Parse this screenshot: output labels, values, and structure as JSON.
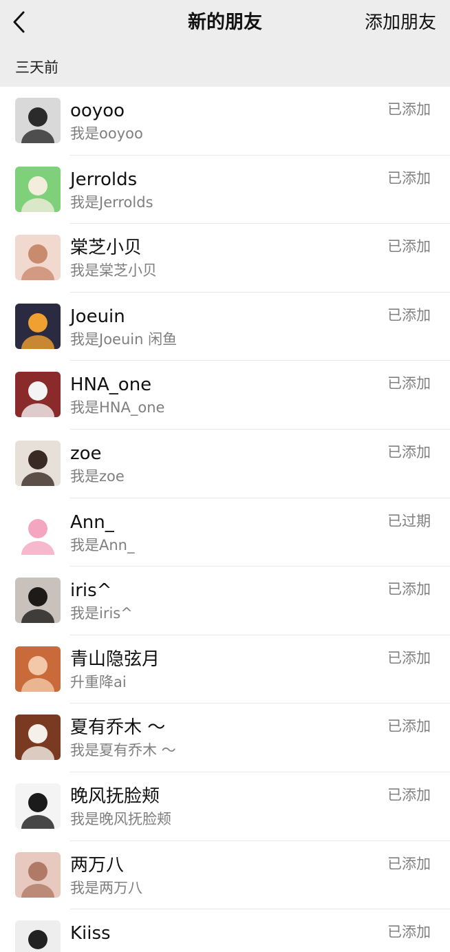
{
  "navbar": {
    "back_icon": "chevron-left-icon",
    "title": "新的朋友",
    "action_label": "添加朋友"
  },
  "section": {
    "label": "三天前"
  },
  "requests": [
    {
      "name": "ooyoo",
      "message": "我是ooyoo",
      "status": "已添加",
      "avatar": "girl-mono-avatar",
      "avatar_bg": "#d9d9d9",
      "avatar_fg": "#2b2b2b"
    },
    {
      "name": "Jerrolds",
      "message": "我是Jerrolds",
      "status": "已添加",
      "avatar": "cartoon-mouse-avatar",
      "avatar_bg": "#7ed07a",
      "avatar_fg": "#f3eedc"
    },
    {
      "name": "棠芝小贝",
      "message": "我是棠芝小贝",
      "status": "已添加",
      "avatar": "selfie-avatar",
      "avatar_bg": "#f2d9cf",
      "avatar_fg": "#c98b6d"
    },
    {
      "name": "Joeuin",
      "message": "我是Joeuin 闲鱼",
      "status": "已添加",
      "avatar": "painting-avatar",
      "avatar_bg": "#2a2a40",
      "avatar_fg": "#f0a030"
    },
    {
      "name": "HNA_one",
      "message": "我是HNA_one",
      "status": "已添加",
      "avatar": "cosplay-avatar",
      "avatar_bg": "#8a2a2a",
      "avatar_fg": "#f4f4f4"
    },
    {
      "name": "zoe",
      "message": "我是zoe",
      "status": "已添加",
      "avatar": "selfie-avatar",
      "avatar_bg": "#e6e0d8",
      "avatar_fg": "#3a2a24"
    },
    {
      "name": "Ann_",
      "message": "我是Ann_",
      "status": "已过期",
      "avatar": "pink-cat-avatar",
      "avatar_bg": "#ffffff",
      "avatar_fg": "#f4a6c0"
    },
    {
      "name": "iris^",
      "message": "我是iris^",
      "status": "已添加",
      "avatar": "girl-photo-avatar",
      "avatar_bg": "#c9c2bc",
      "avatar_fg": "#1e1a18"
    },
    {
      "name": "青山隐弦月",
      "message": "升重降ai",
      "status": "已添加",
      "avatar": "cartoon-starfish-avatar",
      "avatar_bg": "#c86a3a",
      "avatar_fg": "#f2c8a8"
    },
    {
      "name": "夏有乔木 ～",
      "message": "我是夏有乔木 ～",
      "status": "已添加",
      "avatar": "red-panda-avatar",
      "avatar_bg": "#7a3a22",
      "avatar_fg": "#f5f0ea"
    },
    {
      "name": "晚风抚脸颊",
      "message": "我是晚风抚脸颊",
      "status": "已添加",
      "avatar": "anime-girl-avatar",
      "avatar_bg": "#f4f4f4",
      "avatar_fg": "#1b1b1b"
    },
    {
      "name": "两万八",
      "message": "我是两万八",
      "status": "已添加",
      "avatar": "room-photo-avatar",
      "avatar_bg": "#e8c9c0",
      "avatar_fg": "#b07a66"
    },
    {
      "name": "Kiiss",
      "message": "",
      "status": "已添加",
      "avatar": "girl-mono-avatar",
      "avatar_bg": "#eeeeee",
      "avatar_fg": "#222222"
    }
  ]
}
